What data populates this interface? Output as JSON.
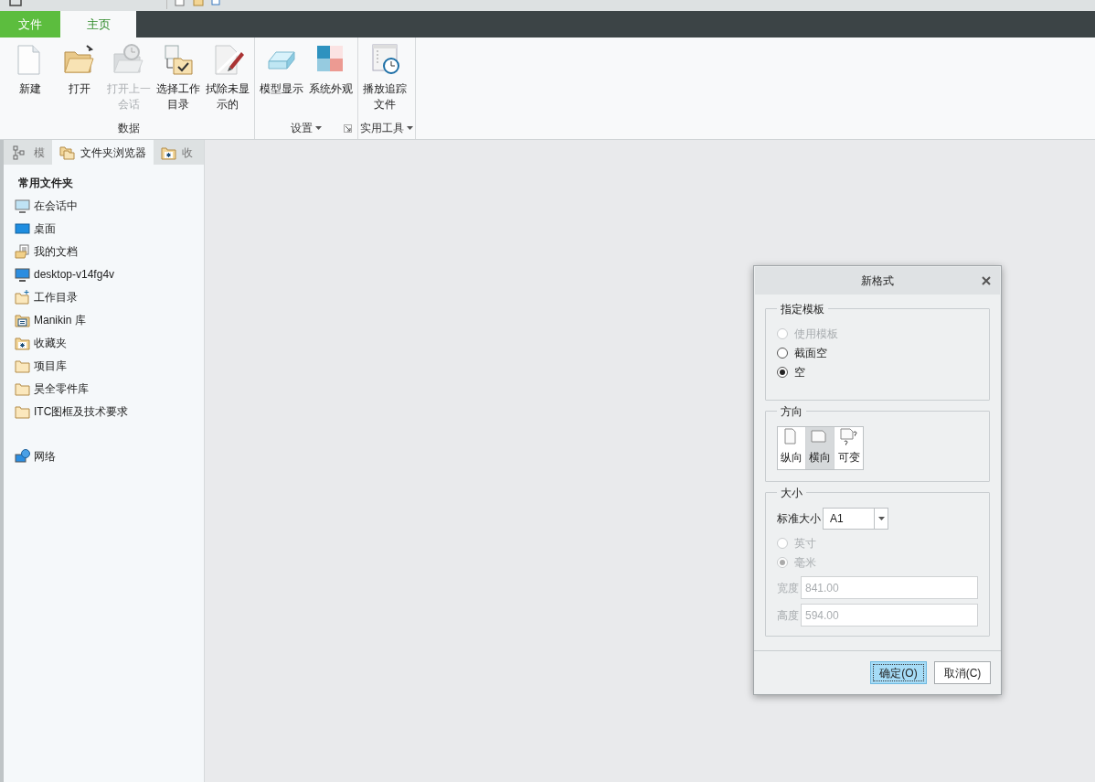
{
  "app_tabs": [
    {
      "label": "文件",
      "kind": "file",
      "selected": false
    },
    {
      "label": "主页",
      "kind": "page",
      "selected": true
    }
  ],
  "ribbon": {
    "groups": [
      {
        "label": "数据",
        "menu": false,
        "launcher": false,
        "buttons": [
          {
            "label": "新建",
            "kind": "new",
            "disabled": false
          },
          {
            "label": "打开",
            "kind": "open",
            "disabled": false
          },
          {
            "label": "打开上一会话",
            "kind": "recent",
            "disabled": true
          },
          {
            "label": "选择工作目录",
            "kind": "workdir",
            "disabled": false
          },
          {
            "label": "拭除未显示的",
            "kind": "erase",
            "disabled": false
          }
        ]
      },
      {
        "label": "设置",
        "menu": true,
        "launcher": true,
        "buttons": [
          {
            "label": "模型显示",
            "kind": "display",
            "disabled": false
          },
          {
            "label": "系统外观",
            "kind": "appearance",
            "disabled": false
          }
        ]
      },
      {
        "label": "实用工具",
        "menu": true,
        "launcher": false,
        "buttons": [
          {
            "label": "播放追踪文件",
            "kind": "trail",
            "disabled": false
          }
        ]
      }
    ]
  },
  "side_panel": {
    "tabs": [
      {
        "label": "模",
        "kind": "tree",
        "selected": false
      },
      {
        "label": "文件夹浏览器",
        "kind": "folders",
        "selected": true
      },
      {
        "label": "收",
        "kind": "favorites",
        "selected": false
      }
    ],
    "heading": "常用文件夹",
    "items": [
      {
        "label": "在会话中",
        "kind": "session"
      },
      {
        "label": "桌面",
        "kind": "desktop"
      },
      {
        "label": "我的文档",
        "kind": "documents"
      },
      {
        "label": "desktop-v14fg4v",
        "kind": "computer"
      },
      {
        "label": "工作目录",
        "kind": "workdir"
      },
      {
        "label": "Manikin 库",
        "kind": "library"
      },
      {
        "label": "收藏夹",
        "kind": "favorites"
      },
      {
        "label": "项目库",
        "kind": "folder"
      },
      {
        "label": "昊全零件库",
        "kind": "folder"
      },
      {
        "label": "ITC图框及技术要求",
        "kind": "folder"
      }
    ],
    "network": {
      "label": "网络"
    }
  },
  "dialog": {
    "title": "新格式",
    "template": {
      "label": "指定模板",
      "options": [
        {
          "label": "使用模板",
          "selected": false,
          "disabled": true
        },
        {
          "label": "截面空",
          "selected": false,
          "disabled": false
        },
        {
          "label": "空",
          "selected": true,
          "disabled": false
        }
      ]
    },
    "orientation": {
      "label": "方向",
      "options": [
        {
          "label": "纵向",
          "kind": "portrait",
          "selected": false
        },
        {
          "label": "横向",
          "kind": "landscape",
          "selected": true
        },
        {
          "label": "可变",
          "kind": "variable",
          "selected": false
        }
      ]
    },
    "size": {
      "label": "大小",
      "standard_label": "标准大小",
      "standard_value": "A1",
      "units": [
        {
          "label": "英寸",
          "selected": false,
          "disabled": true
        },
        {
          "label": "毫米",
          "selected": true,
          "disabled": true
        }
      ],
      "fields": [
        {
          "label": "宽度",
          "value": "841.00",
          "disabled": true
        },
        {
          "label": "高度",
          "value": "594.00",
          "disabled": true
        }
      ]
    },
    "buttons": [
      {
        "label": "确定(O)",
        "default": true
      },
      {
        "label": "取消(C)",
        "default": false
      }
    ]
  }
}
